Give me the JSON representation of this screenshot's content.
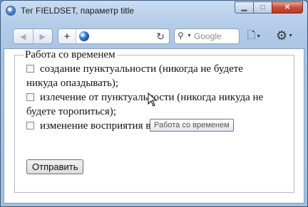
{
  "window": {
    "title": "Тег FIELDSET, параметр title",
    "min_glyph": "▁",
    "max_glyph": "□",
    "close_glyph": "✕"
  },
  "toolbar": {
    "back_glyph": "◀",
    "forward_glyph": "▶",
    "new_tab_glyph": "+",
    "reload_glyph": "↻",
    "address_value": "",
    "search_glyph": "⚲",
    "search_placeholder": "Google",
    "page_menu_glyph": "🗋",
    "tools_menu_glyph": "⚙"
  },
  "form": {
    "legend": "Работа со временем",
    "fieldset_title": "Работа со временем",
    "options": [
      {
        "line1": "создание пунктуальности (никогда не будете",
        "line2": "никуда опаздывать);",
        "checked": false
      },
      {
        "line1": "излечение от пунктуальности (никогда никуда не",
        "line2": "будете торопиться);",
        "checked": false
      },
      {
        "line1": "изменение восприятия времени и часов.",
        "checked": false
      }
    ],
    "submit_label": "Отправить"
  },
  "tooltip": {
    "text": "Работа со временем"
  }
}
